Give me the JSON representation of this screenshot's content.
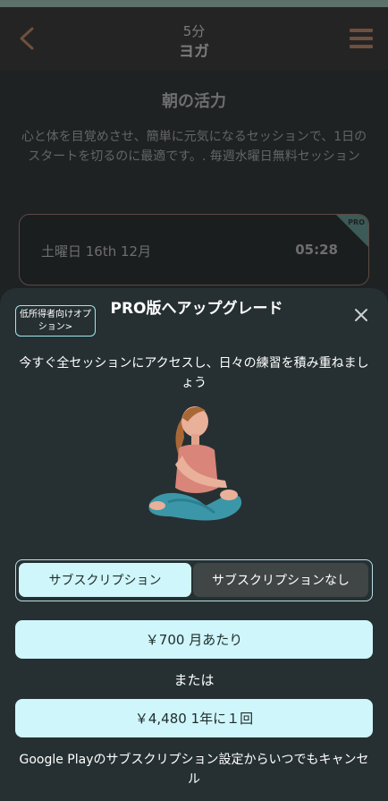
{
  "header": {
    "duration": "5分",
    "name": "ヨガ"
  },
  "session": {
    "title": "朝の活力",
    "description": "心と体を目覚めさせ、簡単に元気になるセッションで、1日のスタートを切るのに最適です。. 毎週水曜日無料セッション",
    "card": {
      "date": "土曜日 16th 12月",
      "time": "05:28",
      "badge": "PRO"
    }
  },
  "sheet": {
    "offer_badge": "低所得者向けオプション>",
    "title": "PRO版へアップグレード",
    "subtitle": "今すぐ全セッションにアクセスし、日々の練習を積み重ねましょう",
    "toggle": {
      "subscription": "サブスクリプション",
      "no_subscription": "サブスクリプションなし"
    },
    "monthly_price": "￥700 月あたり",
    "or_text": "または",
    "yearly_price": "￥4,480 1年に１回",
    "cancel_note": "Google Playのサブスクリプション設定からいつでもキャンセル"
  },
  "colors": {
    "accent_light": "#cff6fb",
    "sheet_bg": "#263032",
    "menu_brown": "#6f4f3d"
  },
  "icons": [
    "chevron-left-icon",
    "hamburger-menu-icon",
    "close-icon"
  ]
}
